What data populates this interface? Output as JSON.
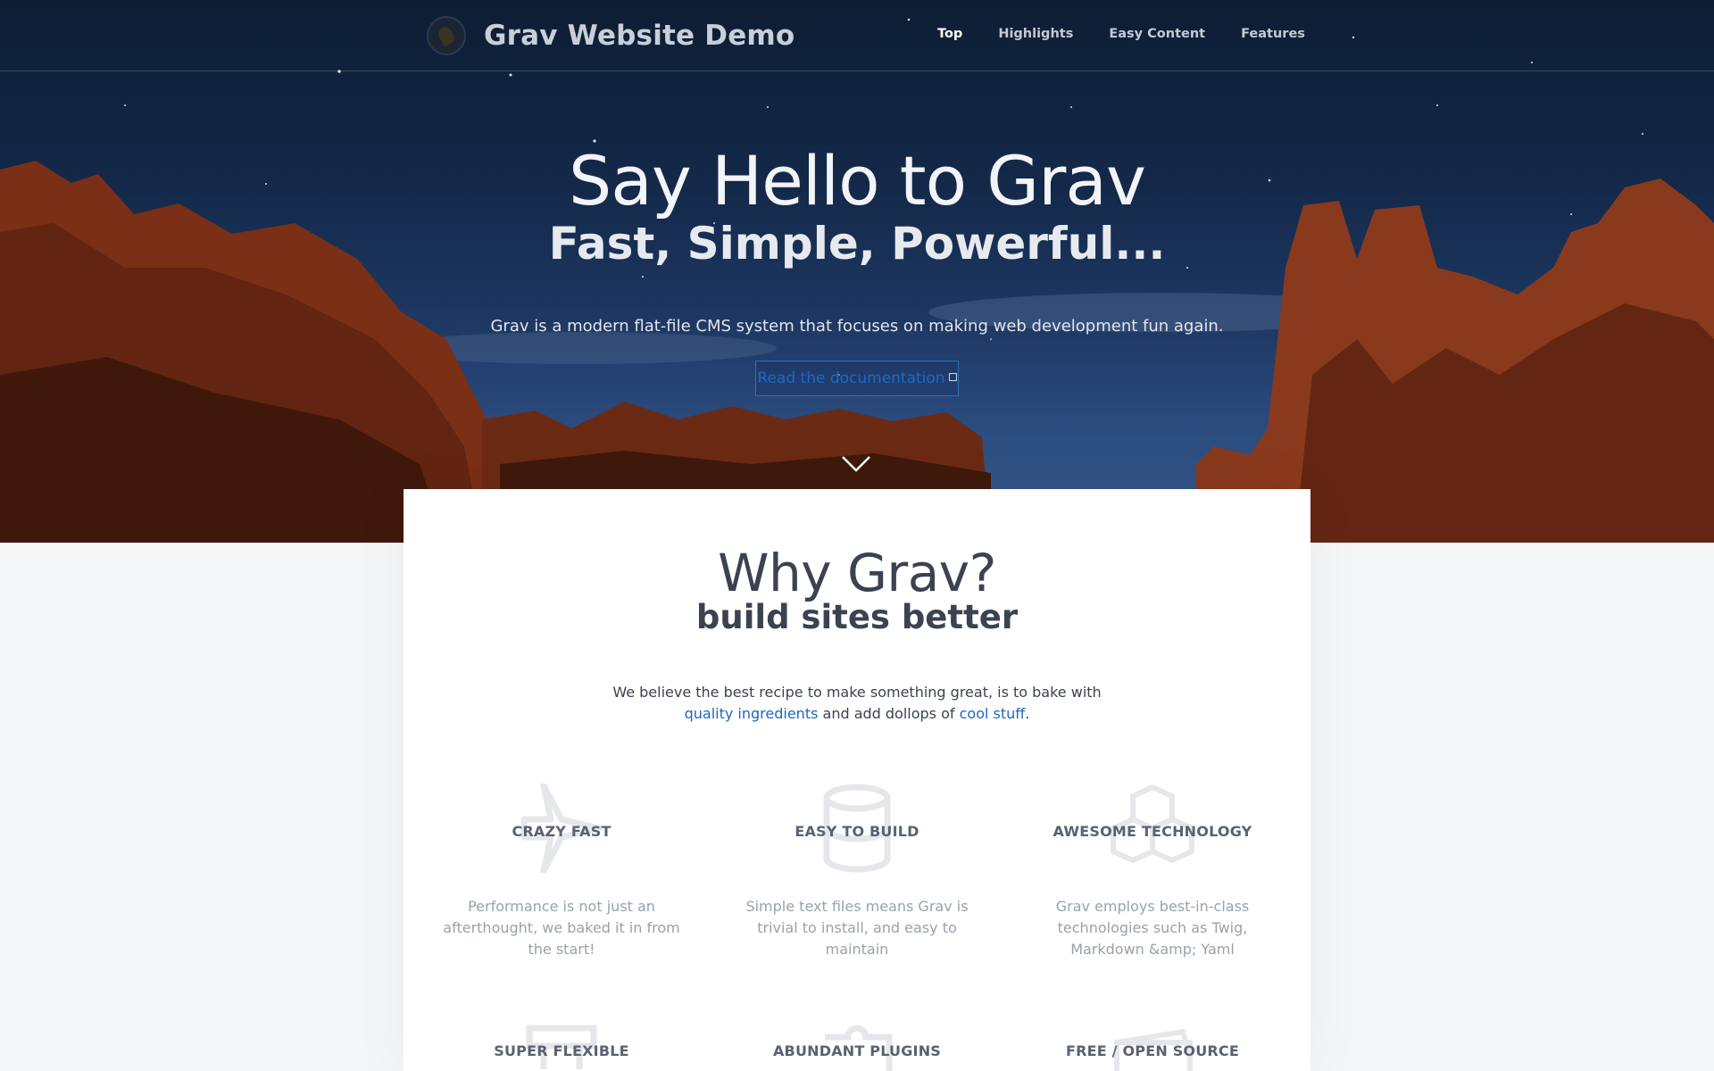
{
  "header": {
    "site_title": "Grav Website Demo",
    "logo": "grav-logo-icon",
    "nav": [
      {
        "label": "Top",
        "active": true
      },
      {
        "label": "Highlights",
        "active": false
      },
      {
        "label": "Easy Content",
        "active": false
      },
      {
        "label": "Features",
        "active": false
      }
    ]
  },
  "hero": {
    "title": "Say Hello to Grav",
    "subtitle": "Fast, Simple, Powerful...",
    "description": "Grav is a modern flat-file CMS system that focuses on making web development fun again.",
    "button_label": "Read the documentation",
    "button_icon": "external-link-icon",
    "scroll_icon": "chevron-down-icon",
    "colors": {
      "sky": "#14294a",
      "rock": "#8a3a1c",
      "link": "#1f68c9"
    }
  },
  "why": {
    "title": "Why Grav?",
    "subtitle": "build sites better",
    "desc_part1": "We believe the best recipe to make something great, is to bake with ",
    "desc_link1": "quality ingredients",
    "desc_part2": " and add dollops of ",
    "desc_link2": "cool stuff",
    "desc_part3": "."
  },
  "features": [
    {
      "title": "CRAZY FAST",
      "icon": "plane-icon",
      "desc": "Performance is not just an afterthought, we baked it in from the start!"
    },
    {
      "title": "EASY TO BUILD",
      "icon": "database-icon",
      "desc": "Simple text files means Grav is trivial to install, and easy to maintain"
    },
    {
      "title": "AWESOME TECHNOLOGY",
      "icon": "cubes-icon",
      "desc": "Grav employs best-in-class technologies such as Twig, Markdown &amp; Yaml"
    },
    {
      "title": "SUPER FLEXIBLE",
      "icon": "sitemap-icon",
      "desc": ""
    },
    {
      "title": "ABUNDANT PLUGINS",
      "icon": "puzzle-icon",
      "desc": ""
    },
    {
      "title": "FREE / OPEN SOURCE",
      "icon": "money-icon",
      "desc": ""
    }
  ]
}
